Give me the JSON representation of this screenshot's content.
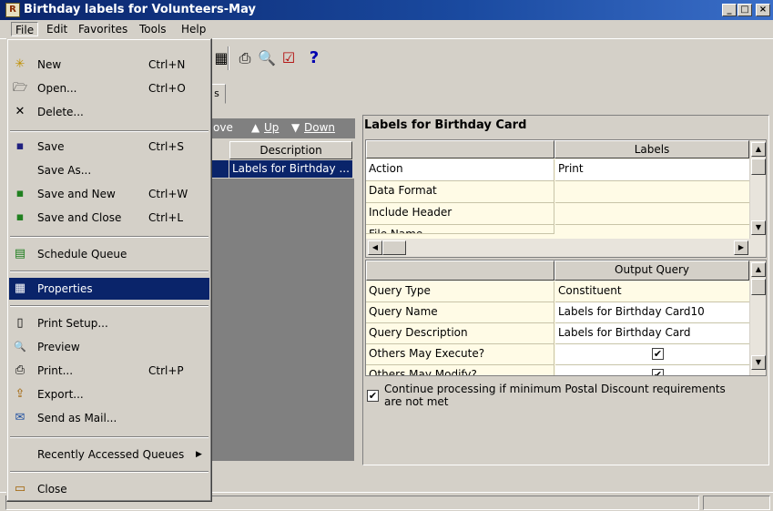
{
  "window": {
    "title": "Birthday labels for Volunteers-May",
    "controls": [
      "_",
      "□",
      "×"
    ]
  },
  "menubar": [
    "File",
    "Edit",
    "Favorites",
    "Tools",
    "Help"
  ],
  "file_menu": {
    "items": [
      {
        "label": "New",
        "shortcut": "Ctrl+N",
        "icon": "new-document-icon",
        "glyph": "✳"
      },
      {
        "label": "Open...",
        "shortcut": "Ctrl+O",
        "icon": "open-folder-icon",
        "glyph": "🗁"
      },
      {
        "label": "Delete...",
        "shortcut": "",
        "icon": "delete-x-icon",
        "glyph": "✕"
      },
      {
        "label": "Save",
        "shortcut": "Ctrl+S",
        "icon": "save-disk-icon",
        "glyph": "▪"
      },
      {
        "label": "Save As...",
        "shortcut": "",
        "icon": "",
        "glyph": ""
      },
      {
        "label": "Save and New",
        "shortcut": "Ctrl+W",
        "icon": "save-new-icon",
        "glyph": "▪"
      },
      {
        "label": "Save and Close",
        "shortcut": "Ctrl+L",
        "icon": "save-close-icon",
        "glyph": "▪"
      },
      {
        "label": "Schedule Queue",
        "shortcut": "",
        "icon": "schedule-queue-icon",
        "glyph": "▤"
      },
      {
        "label": "Properties",
        "shortcut": "",
        "icon": "properties-icon",
        "glyph": "▦"
      },
      {
        "label": "Print Setup...",
        "shortcut": "",
        "icon": "print-setup-icon",
        "glyph": "▯"
      },
      {
        "label": "Preview",
        "shortcut": "",
        "icon": "preview-icon",
        "glyph": "🔍"
      },
      {
        "label": "Print...",
        "shortcut": "Ctrl+P",
        "icon": "printer-icon",
        "glyph": "⎙"
      },
      {
        "label": "Export...",
        "shortcut": "",
        "icon": "export-icon",
        "glyph": "⇪"
      },
      {
        "label": "Send as Mail...",
        "shortcut": "",
        "icon": "mail-icon",
        "glyph": "✉"
      },
      {
        "label": "Recently Accessed Queues",
        "shortcut": "",
        "icon": "",
        "glyph": ""
      },
      {
        "label": "Close",
        "shortcut": "",
        "icon": "close-door-icon",
        "glyph": "▭"
      }
    ],
    "submenu_arrow": "▶"
  },
  "toolbar": {
    "icons": [
      "properties-icon",
      "print-icon",
      "print-preview-icon",
      "check-icon",
      "help-icon"
    ],
    "help_glyph": "?"
  },
  "left_panel": {
    "tab_label": "s",
    "move_label": "ove",
    "up_label": "Up",
    "down_label": "Down",
    "column_header": "Description",
    "rows": [
      "Labels for Birthday ..."
    ]
  },
  "labels_panel": {
    "title": "Labels for Birthday Card",
    "column_header": "Labels",
    "rows": [
      {
        "label": "Action",
        "value": "Print"
      },
      {
        "label": "Data Format",
        "value": ""
      },
      {
        "label": "Include Header",
        "value": ""
      },
      {
        "label": "File Name",
        "value": ""
      }
    ]
  },
  "query_panel": {
    "column_header": "Output Query",
    "rows": [
      {
        "label": "Query Type",
        "value": "Constituent"
      },
      {
        "label": "Query Name",
        "value": "Labels for Birthday Card10"
      },
      {
        "label": "Query Description",
        "value": "Labels for Birthday Card"
      },
      {
        "label": "Others May Execute?",
        "value": "✔"
      },
      {
        "label": "Others May Modify?",
        "value": "✔"
      }
    ]
  },
  "continue_checkbox": {
    "checked": true,
    "label_line1": "Continue processing if minimum Postal Discount requirements",
    "label_line2": "are not met"
  },
  "colors": {
    "highlight": "#0a246a",
    "face": "#d4d0c8",
    "grid_bg": "#fffbe6"
  }
}
